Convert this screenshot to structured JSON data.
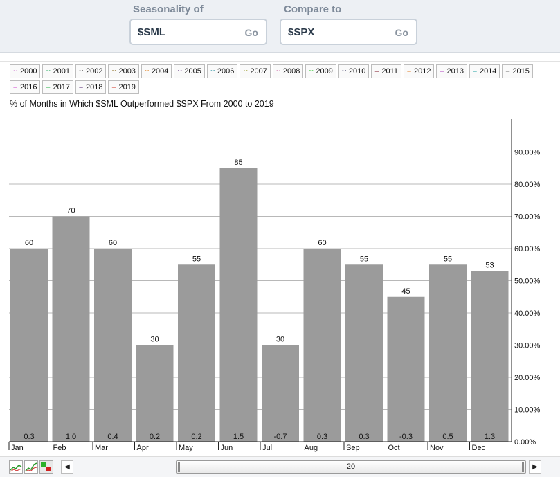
{
  "header": {
    "seasonality_label": "Seasonality of",
    "seasonality_value": "$SML",
    "compare_label": "Compare to",
    "compare_value": "$SPX",
    "go_label": "Go"
  },
  "legend": [
    {
      "label": "2000",
      "color": "#d28ad6"
    },
    {
      "label": "2001",
      "color": "#3cb371"
    },
    {
      "label": "2002",
      "color": "#333333"
    },
    {
      "label": "2003",
      "color": "#8b6b1f"
    },
    {
      "label": "2004",
      "color": "#e08020"
    },
    {
      "label": "2005",
      "color": "#5a2a7a"
    },
    {
      "label": "2006",
      "color": "#2a8fa0"
    },
    {
      "label": "2007",
      "color": "#9a9a2a"
    },
    {
      "label": "2008",
      "color": "#d27ab0"
    },
    {
      "label": "2009",
      "color": "#32c832"
    },
    {
      "label": "2010",
      "color": "#1a1a4a"
    },
    {
      "label": "2011",
      "color": "#7a1020"
    },
    {
      "label": "2012",
      "color": "#e07a20"
    },
    {
      "label": "2013",
      "color": "#b040c0"
    },
    {
      "label": "2014",
      "color": "#1aa0a0"
    },
    {
      "label": "2015",
      "color": "#707070"
    },
    {
      "label": "2016",
      "color": "#d040d0"
    },
    {
      "label": "2017",
      "color": "#20b040"
    },
    {
      "label": "2018",
      "color": "#4a1a6a"
    },
    {
      "label": "2019",
      "color": "#d03020"
    }
  ],
  "chart_data": {
    "type": "bar",
    "title": "% of Months in Which $SML Outperformed $SPX From 2000 to 2019",
    "categories": [
      "Jan",
      "Feb",
      "Mar",
      "Apr",
      "May",
      "Jun",
      "Jul",
      "Aug",
      "Sep",
      "Oct",
      "Nov",
      "Dec"
    ],
    "values": [
      60,
      70,
      60,
      30,
      55,
      85,
      30,
      60,
      55,
      45,
      55,
      53
    ],
    "value_labels": [
      "60",
      "70",
      "60",
      "30",
      "55",
      "85",
      "30",
      "60",
      "55",
      "45",
      "55",
      "53"
    ],
    "bottom_labels": [
      "0.3",
      "1.0",
      "0.4",
      "0.2",
      "0.2",
      "1.5",
      "-0.7",
      "0.3",
      "0.3",
      "-0.3",
      "0.5",
      "1.3"
    ],
    "yticks": [
      "0.00%",
      "10.00%",
      "20.00%",
      "30.00%",
      "40.00%",
      "50.00%",
      "60.00%",
      "70.00%",
      "80.00%",
      "90.00%"
    ],
    "ylim": [
      0,
      100
    ],
    "grid": true,
    "bar_color": "#9b9b9b"
  },
  "footer": {
    "slider_value": "20",
    "left_arrow": "◀",
    "right_arrow": "▶"
  }
}
